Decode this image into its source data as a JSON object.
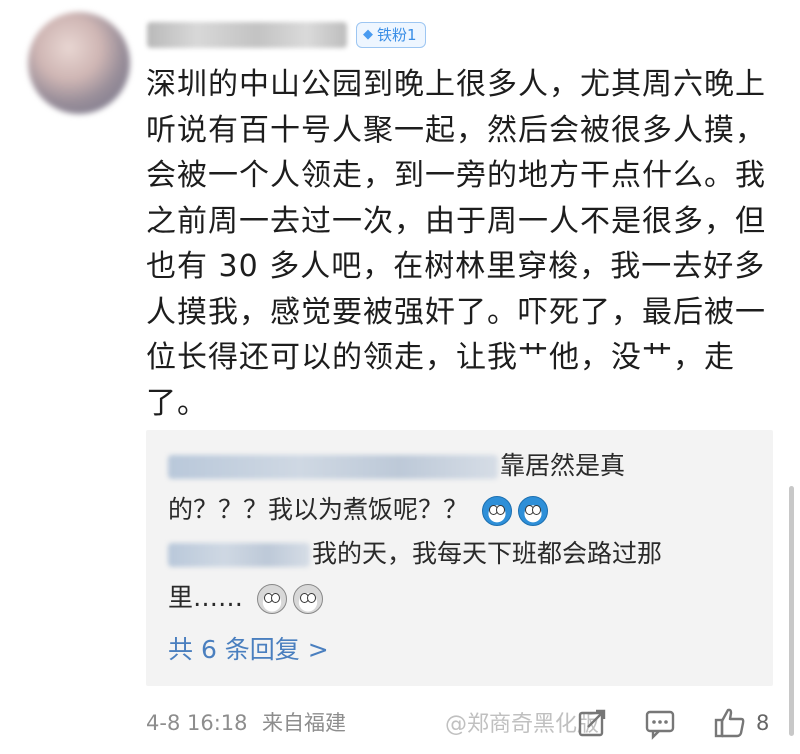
{
  "comment": {
    "fan_badge": "铁粉1",
    "text": "深圳的中山公园到晚上很多人，尤其周六晚上\n听说有百十号人聚一起，然后会被很多人摸，\n会被一个人领走，到一旁的地方干点什么。我\n之前周一去过一次，由于周一人不是很多，但\n也有 30 多人吧，在树林里穿梭，我一去好多\n人摸我，感觉要被强奸了。吓死了，最后被一\n位长得还可以的领走，让我艹他，没艹，走\n了。"
  },
  "replies": [
    {
      "text_line1": "靠居然是真",
      "text_line2": "的？？？我以为煮饭呢？？",
      "emoji": "doraemon-emoji"
    },
    {
      "text_line1": "我的天，我每天下班都会路过那",
      "text_line2": "里……",
      "emoji": "dog-emoji"
    }
  ],
  "more_replies_label": "共 6 条回复 >",
  "footer": {
    "time": "4-8 16:18",
    "source": "来自福建",
    "watermark": "@郑商奇黑化版",
    "like_count": "8"
  },
  "icons": [
    "share-icon",
    "comment-icon",
    "like-icon",
    "diamond-icon"
  ],
  "colors": {
    "badge": "#3a8ee6",
    "link": "#4a7fbf",
    "reply_bg": "#f3f3f3"
  }
}
